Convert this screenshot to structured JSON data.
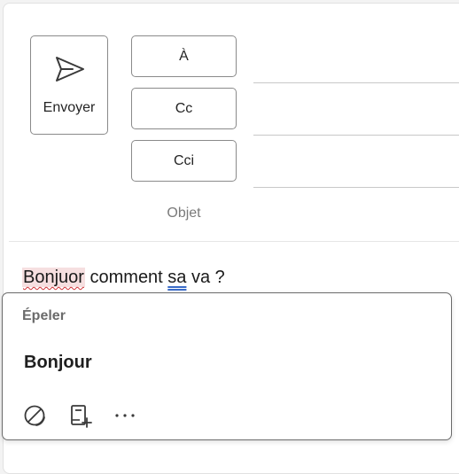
{
  "compose": {
    "send_label": "Envoyer",
    "to_label": "À",
    "cc_label": "Cc",
    "bcc_label": "Cci",
    "subject_placeholder": "Objet"
  },
  "body": {
    "misspelled_word": "Bonjuor",
    "text_middle": " comment ",
    "grammar_word": "sa",
    "text_end": " va ?"
  },
  "spelling_popup": {
    "title": "Épeler",
    "suggestion": "Bonjour",
    "actions": [
      "ignore-icon",
      "add-to-dictionary-icon",
      "more-options-icon"
    ]
  },
  "colors": {
    "misspelling_underline": "#d13438",
    "misspelling_highlight": "#f6dfe0",
    "grammar_underline": "#3b6cc7"
  }
}
